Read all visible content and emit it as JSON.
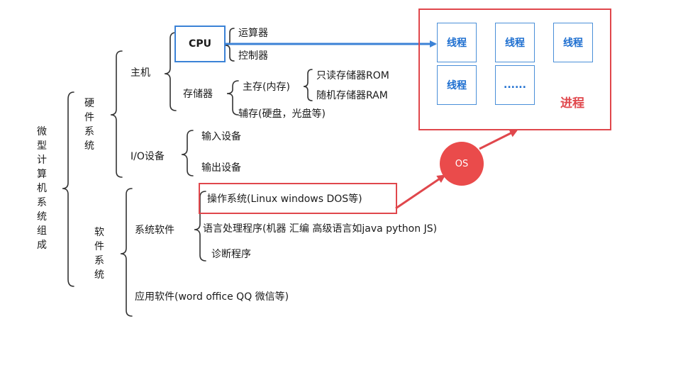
{
  "root": "微型计算机系统组成",
  "hardware": {
    "label": "硬件系统",
    "host": {
      "label": "主机",
      "cpu": {
        "label": "CPU",
        "children": [
          "运算器",
          "控制器"
        ]
      },
      "memory": {
        "label": "存储器",
        "main": {
          "label": "主存(内存)",
          "children": [
            "只读存储器ROM",
            "随机存储器RAM"
          ]
        },
        "aux": "辅存(硬盘，光盘等)"
      }
    },
    "io": {
      "label": "I/O设备",
      "children": [
        "输入设备",
        "输出设备"
      ]
    }
  },
  "software": {
    "label": "软件系统",
    "system_software": {
      "label": "系统软件",
      "children": [
        "操作系统(Linux windows DOS等)",
        "语言处理程序(机器 汇编 高级语言如java python JS)",
        "诊断程序"
      ]
    },
    "application": "应用软件(word office QQ 微信等)"
  },
  "process": {
    "label": "进程",
    "threads": [
      "线程",
      "线程",
      "线程",
      "线程",
      "......"
    ]
  },
  "os_node": "OS",
  "colors": {
    "blue": "#3b82d6",
    "red": "#e0474c",
    "thread_text": "#1e6fd0"
  }
}
